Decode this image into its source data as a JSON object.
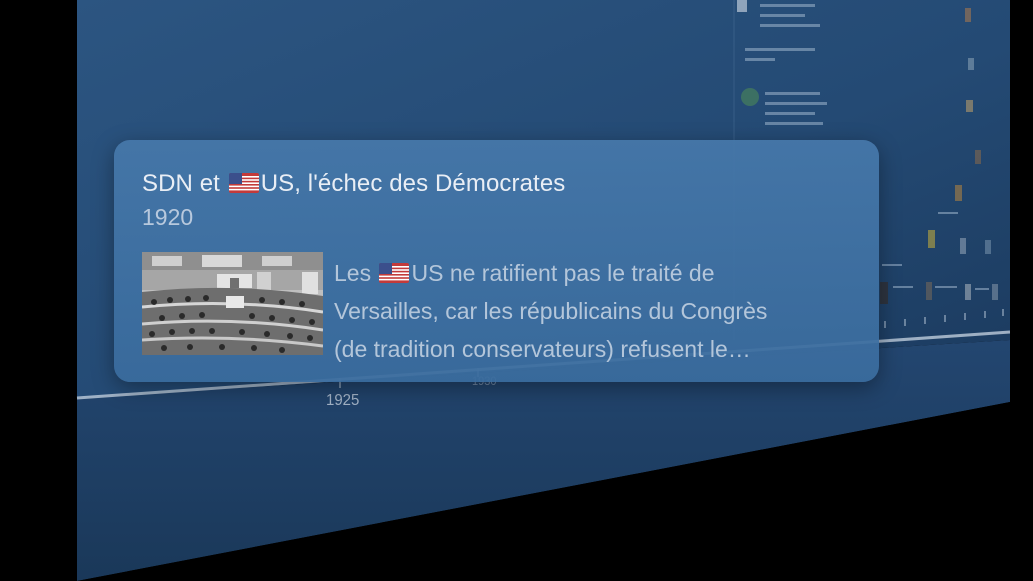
{
  "timeline": {
    "axis_labels": [
      "1925",
      "1930"
    ]
  },
  "event_card": {
    "title_before_flag": "SDN et ",
    "flag_icon": "us-flag-icon",
    "title_after_flag": "US, l'échec des Démocrates",
    "year": "1920",
    "description_line1_before_flag": "Les ",
    "description_line1_after_flag": "US ne ratifient pas le traité de",
    "description_line2": "Versailles, car les républicains du Congrès",
    "description_line3": "(de tradition conservateurs) refusent le…",
    "thumbnail_icon": "congress-chamber-photo"
  },
  "colors": {
    "plane": "#23446a",
    "card": "#4678aa",
    "axis": "#c9d6e4"
  }
}
